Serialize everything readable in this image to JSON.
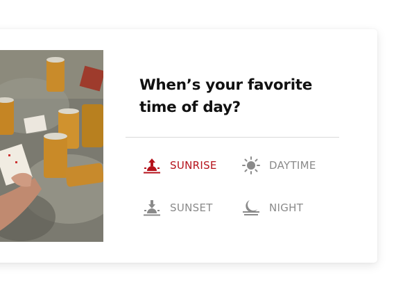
{
  "question": {
    "title": "When’s your favorite time of day?"
  },
  "options": [
    {
      "label": "SUNRISE",
      "icon": "sunrise-icon",
      "selected": true
    },
    {
      "label": "DAYTIME",
      "icon": "sun-icon",
      "selected": false
    },
    {
      "label": "SUNSET",
      "icon": "sunset-icon",
      "selected": false
    },
    {
      "label": "NIGHT",
      "icon": "moon-icon",
      "selected": false
    }
  ],
  "colors": {
    "accent": "#b5121b",
    "inactive": "#8a8a8a",
    "title": "#111111"
  }
}
